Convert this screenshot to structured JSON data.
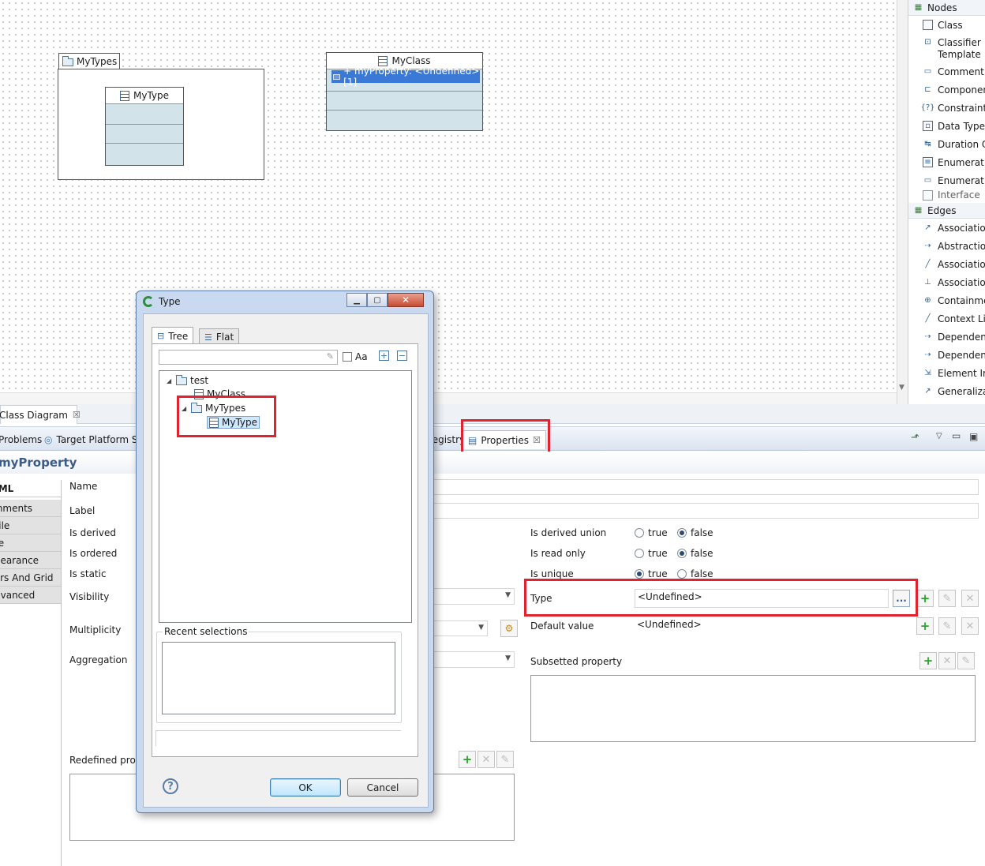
{
  "diagram": {
    "package": {
      "name": "MyTypes",
      "inner_class": "MyType"
    },
    "class": {
      "name": "MyClass",
      "property": "+ myProperty: <Undefined> [1]"
    }
  },
  "palette": {
    "nodes_title": "Nodes",
    "nodes": [
      "Class",
      "Classifier Template Parameter",
      "Comment",
      "Component",
      "Constraint",
      "Data Type",
      "Duration Observation",
      "Enumeration",
      "Enumeration Literal",
      "Interface"
    ],
    "edges_title": "Edges",
    "edges": [
      "Association",
      "Abstraction",
      "Association",
      "Association",
      "Containment",
      "Context Link",
      "Dependency",
      "Dependency",
      "Element Import",
      "Generalization"
    ]
  },
  "editor": {
    "tab": "Class Diagram"
  },
  "views": {
    "problems": "Problems",
    "target_platform": "Target Platform St",
    "registry": "Registry",
    "properties": "Properties"
  },
  "properties": {
    "title": "myProperty",
    "side_tabs": [
      "UML",
      "Comments",
      "Profile",
      "Style",
      "Appearance",
      "Rulers And Grid",
      "Advanced"
    ],
    "labels": {
      "name": "Name",
      "label": "Label",
      "is_derived": "Is derived",
      "is_ordered": "Is ordered",
      "is_static": "Is static",
      "visibility": "Visibility",
      "multiplicity": "Multiplicity",
      "aggregation": "Aggregation",
      "redefined": "Redefined property",
      "is_derived_union": "Is derived union",
      "is_read_only": "Is read only",
      "is_unique": "Is unique",
      "type": "Type",
      "default_value": "Default value",
      "subsetted": "Subsetted property"
    },
    "type_value": "<Undefined>",
    "default_value": "<Undefined>",
    "true_label": "true",
    "false_label": "false",
    "browse_label": "..."
  },
  "dialog": {
    "title": "Type",
    "tab_tree": "Tree",
    "tab_flat": "Flat",
    "case_label": "Aa",
    "tree": {
      "root": "test",
      "class": "MyClass",
      "package": "MyTypes",
      "type": "MyType"
    },
    "recent_label": "Recent selections",
    "ok": "OK",
    "cancel": "Cancel",
    "help": "?"
  },
  "highlight_color": "#e0232f"
}
